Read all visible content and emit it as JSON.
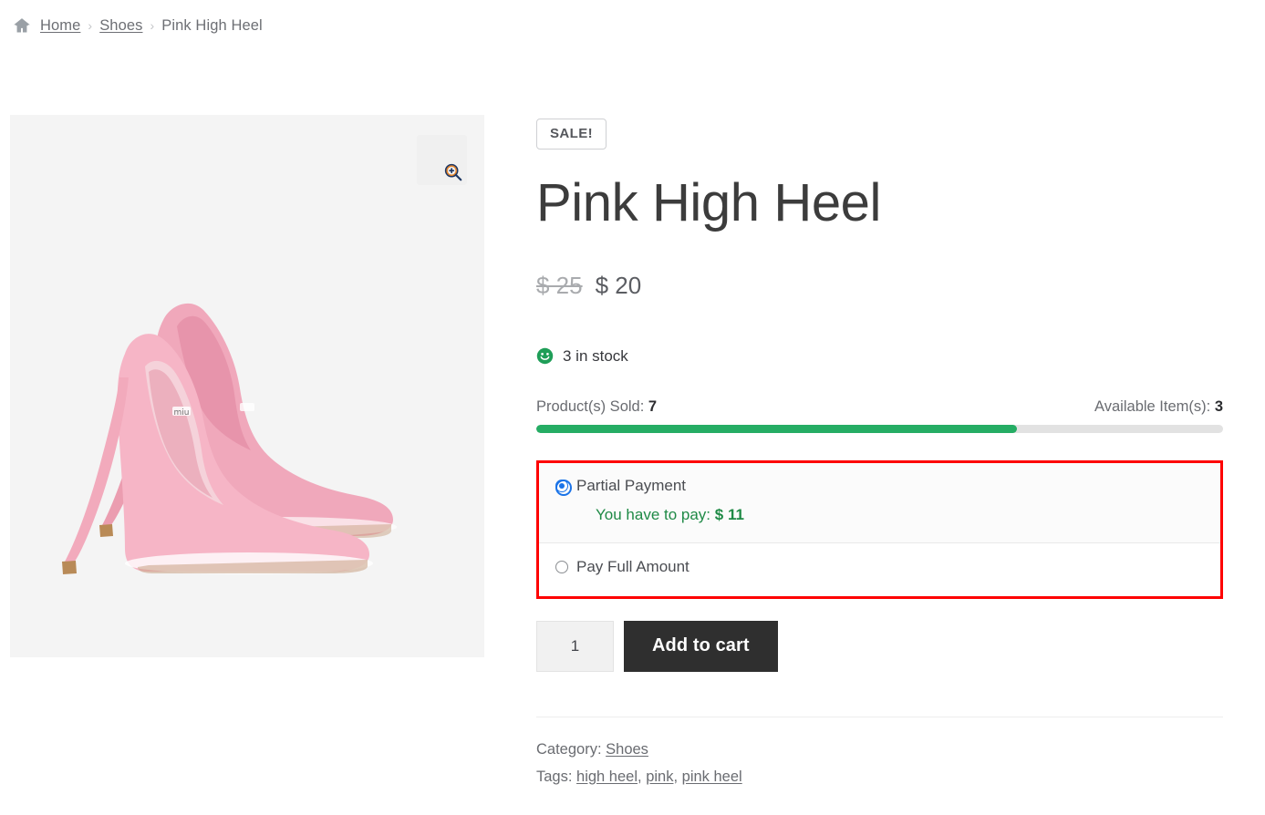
{
  "breadcrumb": {
    "home_icon": "home-icon",
    "home": "Home",
    "separator": "›",
    "category": "Shoes",
    "current": "Pink High Heel"
  },
  "gallery": {
    "zoom_icon": "magnifier-plus-icon",
    "image_alt": "Pink High Heel pumps"
  },
  "summary": {
    "sale_badge": "SALE!",
    "title": "Pink High Heel",
    "price_old": "$ 25",
    "price_new": "$ 20",
    "stock_icon": "smiley-face-icon",
    "stock_text": "3 in stock",
    "sold_label": "Product(s) Sold:",
    "sold_value": "7",
    "available_label": "Available Item(s):",
    "available_value": "3",
    "progress_percent": 70,
    "progress_fill_color": "#25ad64",
    "progress_track_color": "#e2e2e2"
  },
  "payment": {
    "highlight_color": "#fe0000",
    "accent_color": "#1a73e8",
    "options": [
      {
        "label": "Partial Payment",
        "selected": true
      },
      {
        "label": "Pay Full Amount",
        "selected": false
      }
    ],
    "note_prefix": "You have to pay:",
    "note_amount": "$ 11",
    "note_color": "#1f8a46"
  },
  "cart": {
    "quantity_value": "1",
    "quantity_placeholder": "1",
    "add_to_cart_label": "Add to cart"
  },
  "meta": {
    "category_label": "Category:",
    "category_value": "Shoes",
    "tags_label": "Tags:",
    "tags": [
      "high heel",
      "pink",
      "pink heel"
    ],
    "tag_separator": ", "
  }
}
